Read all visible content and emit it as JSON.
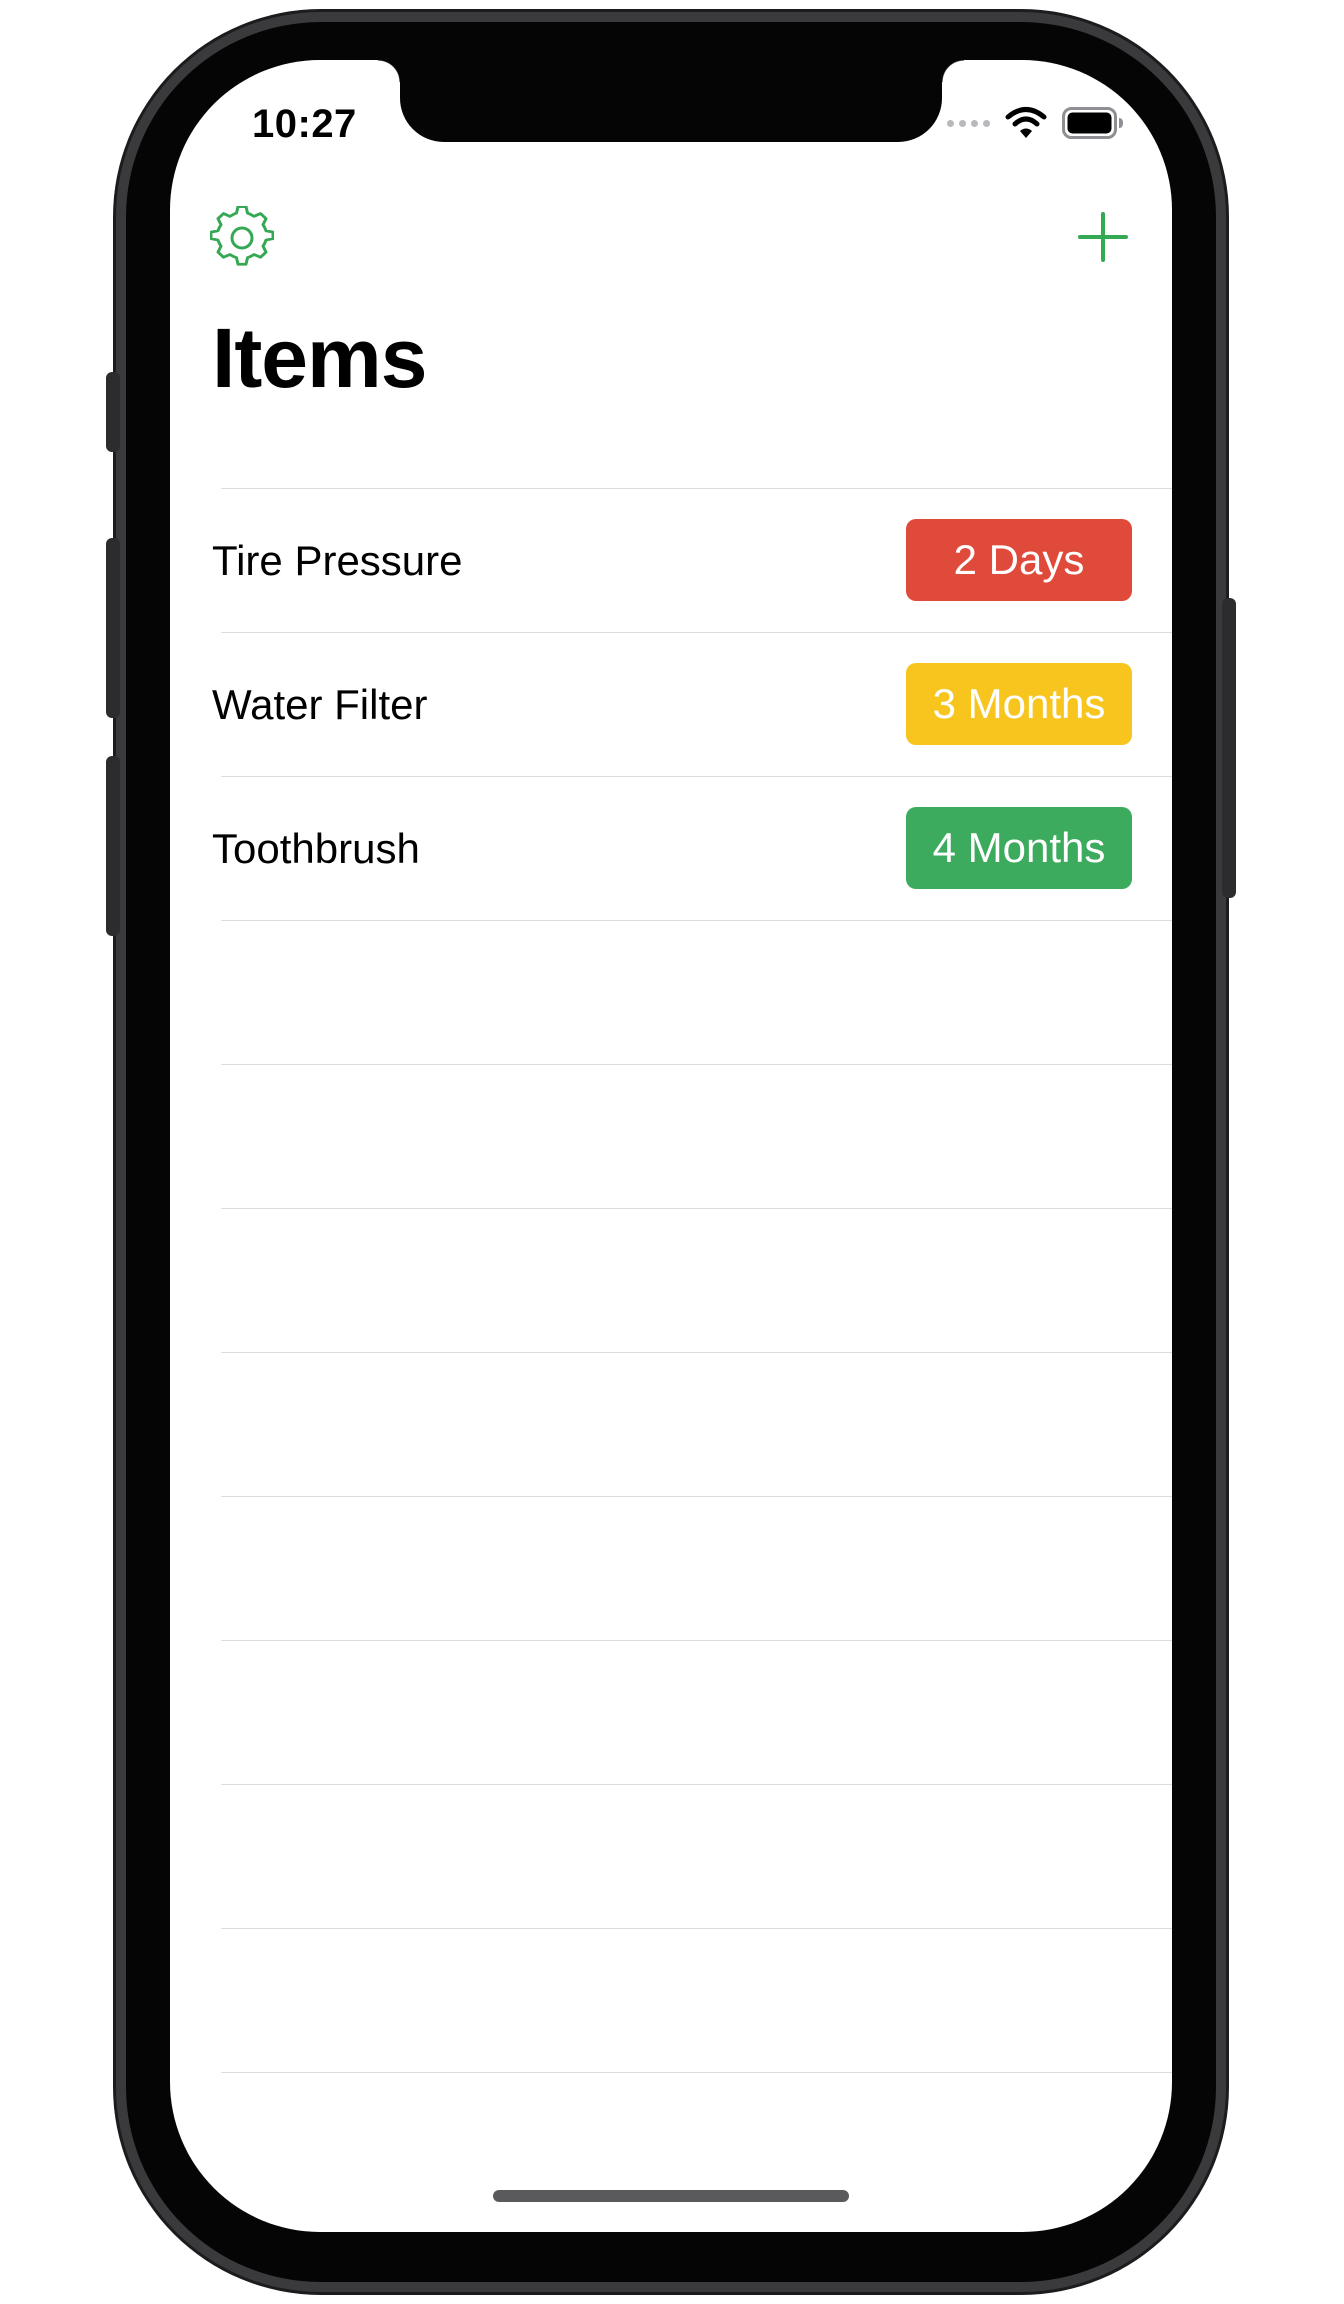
{
  "status_bar": {
    "time": "10:27",
    "icons": [
      "signal-dots-icon",
      "wifi-icon",
      "battery-icon"
    ]
  },
  "nav": {
    "left_icon": "gear-icon",
    "right_icon": "plus-icon",
    "accent_color": "#34a853"
  },
  "title": "Items",
  "items": [
    {
      "label": "Tire Pressure",
      "badge": "2 Days",
      "badge_color": "#e04a3a"
    },
    {
      "label": "Water Filter",
      "badge": "3 Months",
      "badge_color": "#f7c51e"
    },
    {
      "label": "Toothbrush",
      "badge": "4 Months",
      "badge_color": "#3dab5e"
    }
  ],
  "empty_row_count": 8
}
